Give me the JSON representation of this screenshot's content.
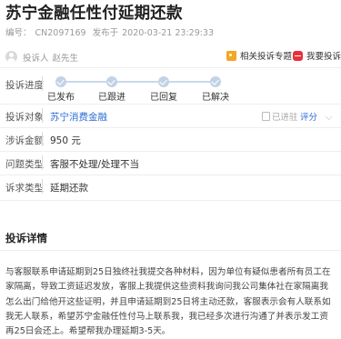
{
  "complaint": {
    "title": "苏宁金融任性付延期还款",
    "number_label": "编号：",
    "number": "CN2097169",
    "published_label": "发布于",
    "published_at": "2020-03-21 23:29:33"
  },
  "complainant": {
    "label": "投诉人",
    "name": "赵先生"
  },
  "actions": {
    "related_label": "相关投诉专题",
    "me_too_label": "我要投诉"
  },
  "progress": {
    "label": "投诉进度",
    "steps": [
      "已发布",
      "已跟进",
      "已回复",
      "已解决"
    ]
  },
  "details": {
    "target_label": "投诉对象",
    "target_value": "苏宁消费金融",
    "target_status": "已进驻",
    "rate_label": "评分",
    "amount_label": "涉诉金额",
    "amount_value": "950 元",
    "issue_label": "问题类型",
    "issue_value": "客服不处理/处理不当",
    "demand_label": "诉求类型",
    "demand_value": "延期还款"
  },
  "detail_section": {
    "heading": "投诉详情",
    "text": "与客服联系申请延期到25日独终社我提交各种材料，因为单位有疑似患者所有员工在家隔离，导致工资延迟发放，客服上我提供这些资料我询问我公司集体社在家隔离我怎么出门给他开这些证明，并且申请延期到25日将主动还款，客服表示会有人联系如我无人联系，希望苏宁金融任性付马上联系我，我已经多次进行沟通了并表示发工资再25日会还上。希望帮我办理延期3-5天。"
  },
  "colors": {
    "accent": "#2d6ed4",
    "progress": "#c3d2e6",
    "brand_orange": "#f5a623",
    "brand_red": "#e8313a"
  }
}
